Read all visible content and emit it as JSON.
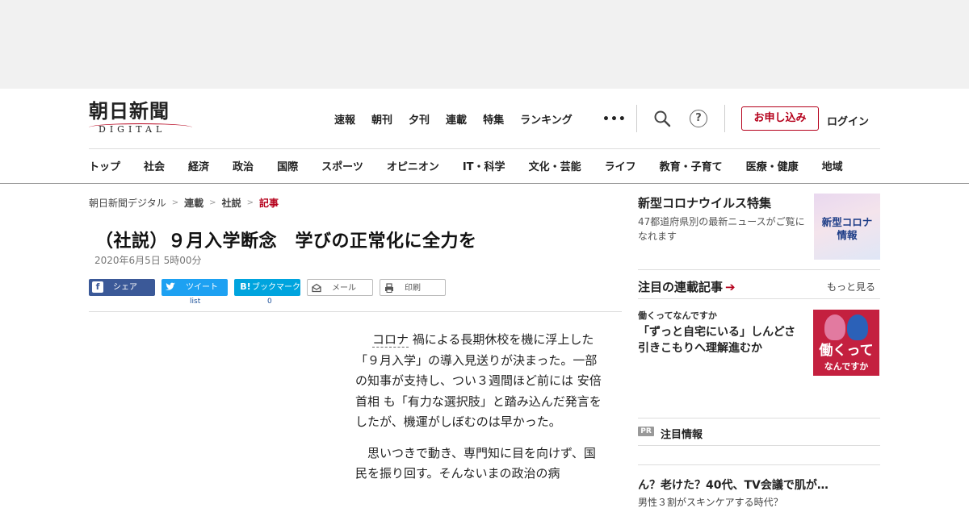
{
  "logo": {
    "ja": "朝日新聞",
    "en": "DIGITAL"
  },
  "topnav": [
    "速報",
    "朝刊",
    "夕刊",
    "連載",
    "特集",
    "ランキング"
  ],
  "more_dots": "•••",
  "help_glyph": "?",
  "apply_label": "お申し込み",
  "login_label": "ログイン",
  "categories": [
    "トップ",
    "社会",
    "経済",
    "政治",
    "国際",
    "スポーツ",
    "オピニオン",
    "IT・科学",
    "文化・芸能",
    "ライフ",
    "教育・子育て",
    "医療・健康",
    "地域"
  ],
  "breadcrumb": [
    "朝日新聞デジタル",
    "連載",
    "社説",
    "記事"
  ],
  "article": {
    "title": "（社説）９月入学断念　学びの正常化に全力を",
    "date": "2020年6月5日 5時00分",
    "share": {
      "facebook": "シェア",
      "twitter": "ツイート",
      "hatena": "ブックマーク",
      "mail": "メール",
      "print": "印刷",
      "twitter_count": "list",
      "hatena_count": "0"
    },
    "p1_kw1": "コロナ",
    "p1_a": "禍による長期休校を機に浮上した「９月入学」の導入見送りが決まった。一部の知事が支持し、つい３週間ほど前には",
    "p1_kw2": "安倍首相",
    "p1_b": "も「有力な選択肢」と踏み込んだ発言をしたが、機運がしぼむのは早かった。",
    "p2": "思いつきで動き、専門知に目を向けず、国民を振り回す。そんないまの政治の病"
  },
  "sidebar": {
    "promo_title": "新型コロナウイルス特集",
    "promo_desc": "47都道府県別の最新ニュースがご覧になれます",
    "promo_img_line1": "新型コロナ",
    "promo_img_line2": "情報",
    "section_title": "注目の連載記事",
    "more": "もっと見る",
    "series_label": "働くってなんですか",
    "series_title": "「ずっと自宅にいる」しんどさ　引きこもりへ理解進むか",
    "series_img_big": "働くって",
    "series_img_small": "なんですか",
    "pr_badge": "PR",
    "pr_label": "注目情報",
    "pr_title": "ん？老けた？40代、TV会議で肌が…",
    "pr_sub": "男性３割がスキンケアする時代？"
  }
}
